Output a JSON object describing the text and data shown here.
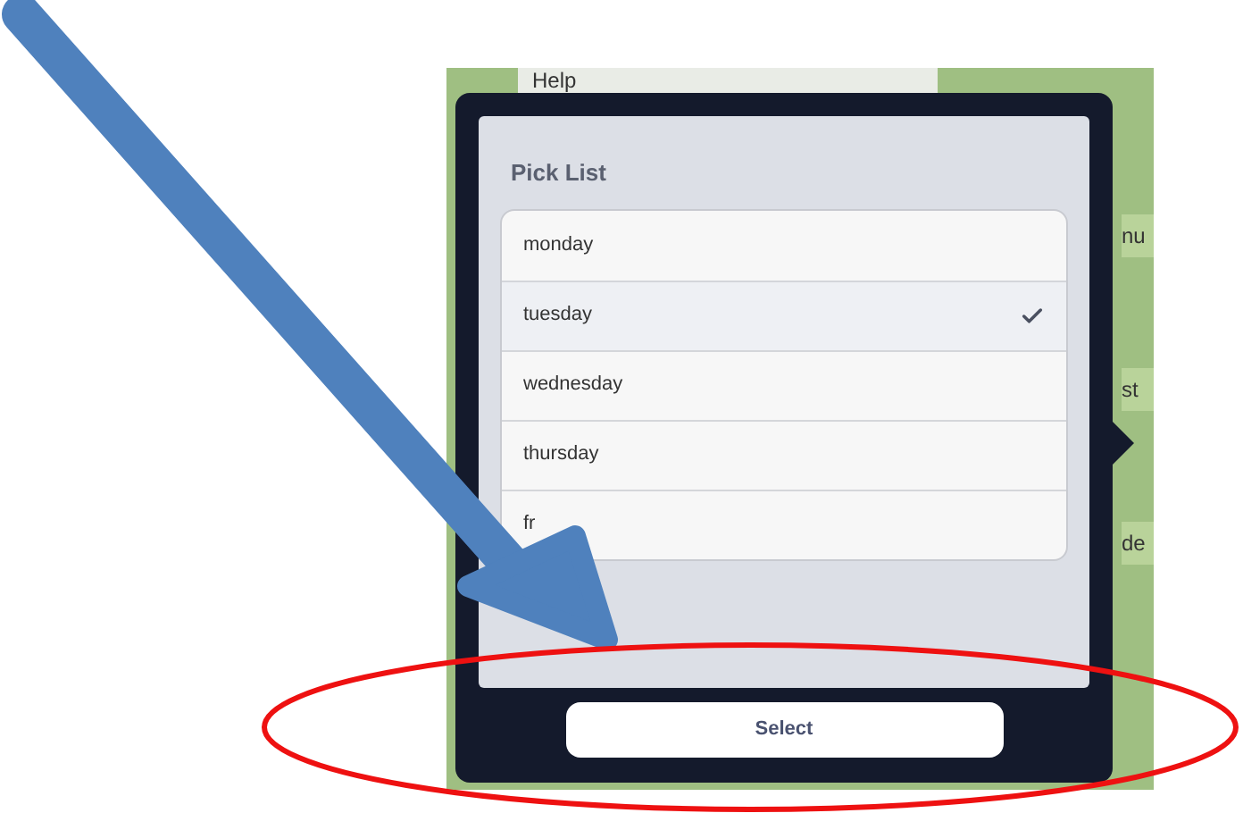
{
  "background_app": {
    "top_item": "Help",
    "side_labels": [
      "nu",
      "st",
      "de"
    ]
  },
  "popover": {
    "title": "Pick List",
    "items": [
      {
        "label": "monday",
        "selected": false
      },
      {
        "label": "tuesday",
        "selected": true
      },
      {
        "label": "wednesday",
        "selected": false
      },
      {
        "label": "thursday",
        "selected": false
      },
      {
        "label": "fr",
        "selected": false
      }
    ],
    "button": "Select"
  }
}
